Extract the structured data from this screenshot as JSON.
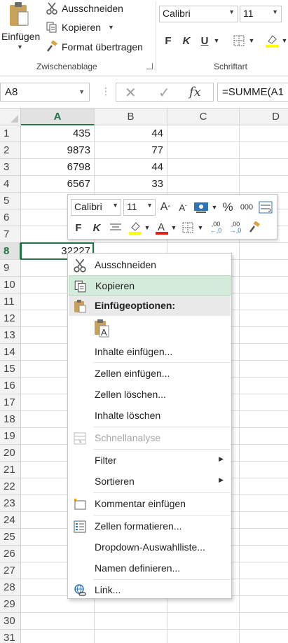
{
  "ribbon": {
    "clipboard": {
      "paste": "Einfügen",
      "cut": "Ausschneiden",
      "copy": "Kopieren",
      "format_painter": "Format übertragen",
      "group_label": "Zwischenablage"
    },
    "font": {
      "font_name": "Calibri",
      "font_size": "11",
      "bold": "F",
      "italic": "K",
      "underline": "U",
      "group_label": "Schriftart"
    }
  },
  "formula_bar": {
    "name_box": "A8",
    "cancel_icon": "✕",
    "enter_icon": "✓",
    "function_icon": "fx",
    "formula": "=SUMME(A1"
  },
  "sheet": {
    "columns": [
      "A",
      "B",
      "C",
      "D"
    ],
    "selected_column": "A",
    "rows": [
      "1",
      "2",
      "3",
      "4",
      "5",
      "6",
      "7",
      "8",
      "9",
      "10",
      "11",
      "12",
      "13",
      "14",
      "15",
      "16",
      "17",
      "18",
      "19",
      "20",
      "21",
      "22",
      "23",
      "24",
      "25",
      "26",
      "27",
      "28",
      "29",
      "30",
      "31"
    ],
    "selected_row": "8",
    "cells": {
      "A1": "435",
      "B1": "44",
      "A2": "9873",
      "B2": "77",
      "A3": "6798",
      "B3": "44",
      "A4": "6567",
      "B4": "33",
      "A8": "32227"
    }
  },
  "mini_toolbar": {
    "font_name": "Calibri",
    "font_size": "11",
    "grow_font": "A",
    "shrink_font": "A",
    "percent": "%",
    "thousands": "000",
    "bold": "F",
    "italic": "K",
    "increase_decimal": ",00",
    "decrease_decimal": ",00"
  },
  "context_menu": {
    "cut": "Ausschneiden",
    "copy": "Kopieren",
    "paste_options": "Einfügeoptionen:",
    "paste_special": "Inhalte einfügen...",
    "insert_cells": "Zellen einfügen...",
    "delete_cells": "Zellen löschen...",
    "clear_contents": "Inhalte löschen",
    "quick_analysis": "Schnellanalyse",
    "filter": "Filter",
    "sort": "Sortieren",
    "insert_comment": "Kommentar einfügen",
    "format_cells": "Zellen formatieren...",
    "dropdown_list": "Dropdown-Auswahlliste...",
    "define_name": "Namen definieren...",
    "link": "Link..."
  },
  "colors": {
    "accent_green": "#217346",
    "highlight": "#d4eadb",
    "font_color_red": "#e02020",
    "highlight_yellow": "#ffff00"
  }
}
